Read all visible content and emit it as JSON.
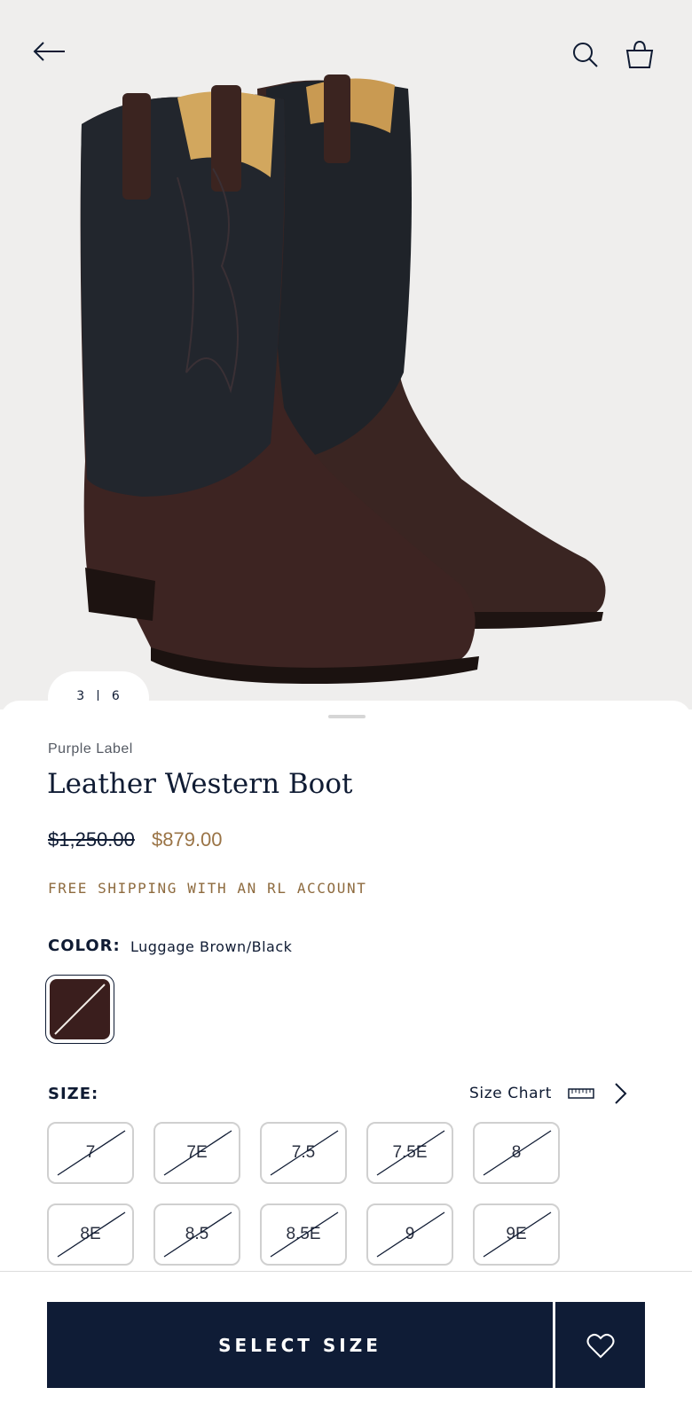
{
  "header": {
    "back_icon": "arrow-left-icon",
    "search_icon": "search-icon",
    "bag_icon": "shopping-bag-icon"
  },
  "gallery": {
    "current": "3",
    "total": "6",
    "image_alt": "leather-western-boots-image"
  },
  "product": {
    "brand": "Purple Label",
    "name": "Leather Western Boot",
    "original_price": "$1,250.00",
    "sale_price": "$879.00",
    "shipping_note": "FREE SHIPPING WITH AN RL ACCOUNT"
  },
  "color": {
    "label": "COLOR:",
    "value": "Luggage Brown/Black",
    "swatch_color": "#3a1e1d"
  },
  "size": {
    "label": "SIZE:",
    "chart_label": "Size Chart",
    "options": [
      "7",
      "7E",
      "7.5",
      "7.5E",
      "8",
      "8E",
      "8.5",
      "8.5E",
      "9",
      "9E"
    ],
    "all_unavailable": true
  },
  "actions": {
    "select_size": "SELECT SIZE",
    "wishlist_icon": "heart-icon"
  },
  "colors": {
    "navy": "#0f1c36",
    "gold": "#9a7446",
    "hero_bg": "#efeeed"
  }
}
